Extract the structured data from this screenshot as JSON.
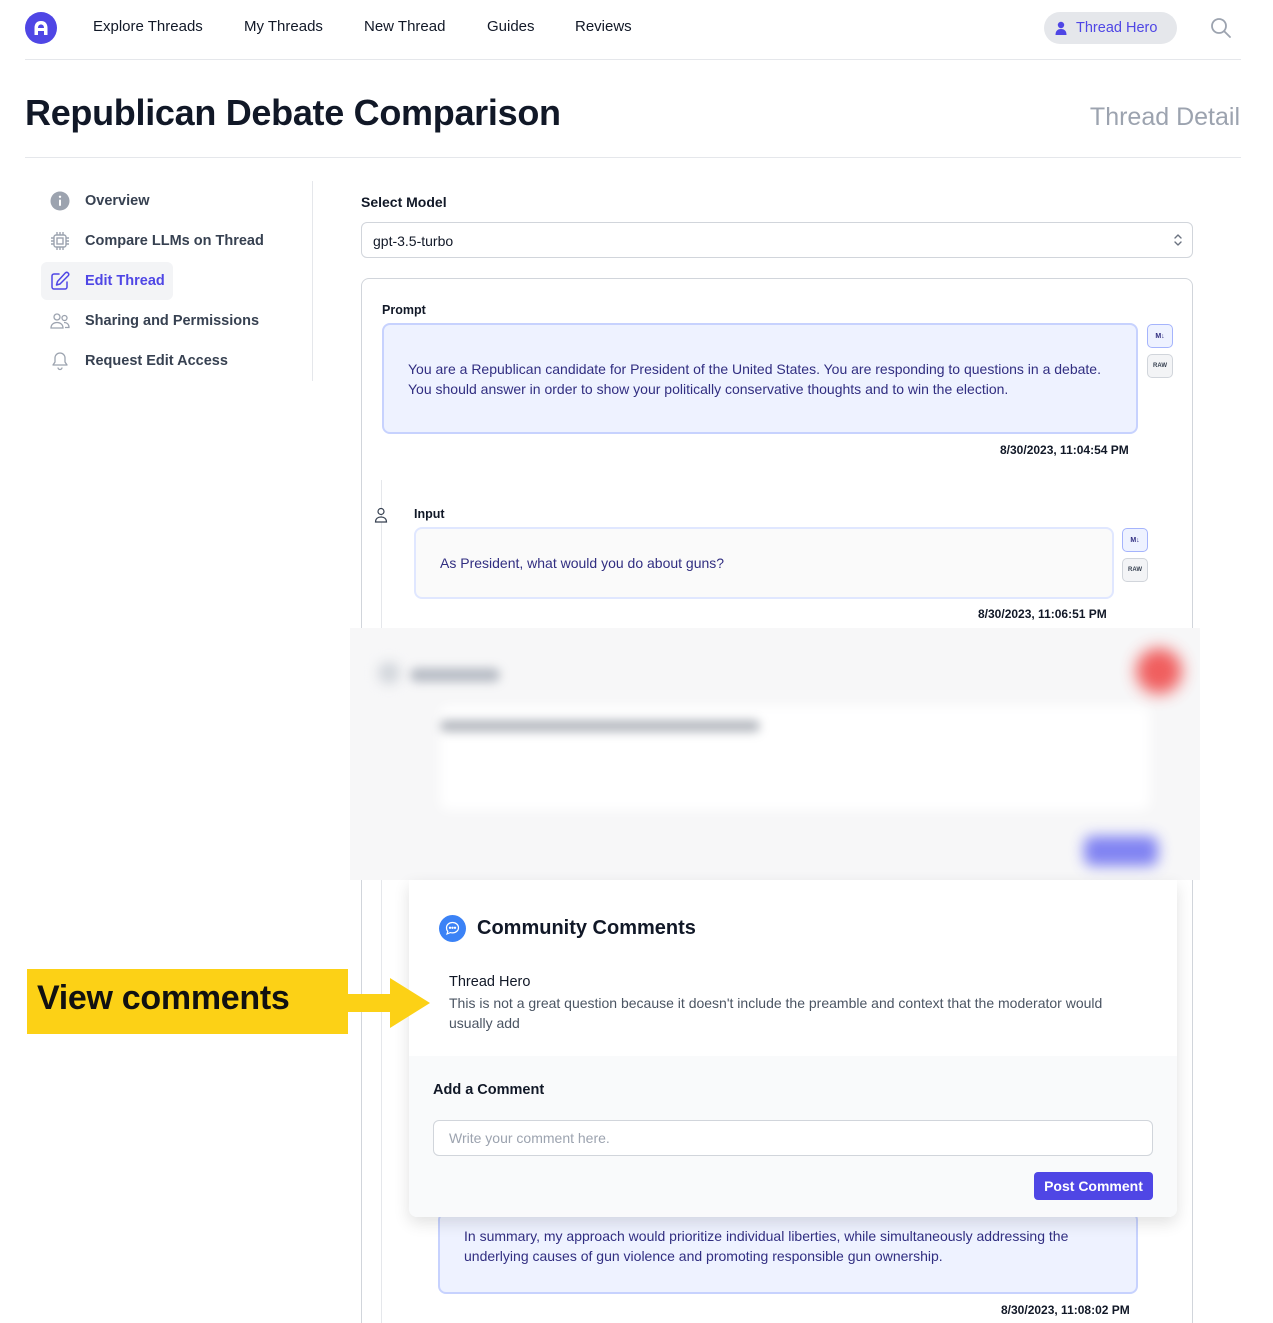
{
  "nav": {
    "items": [
      "Explore Threads",
      "My Threads",
      "New Thread",
      "Guides",
      "Reviews"
    ],
    "user_name": "Thread Hero",
    "brand_color": "#4f46e5"
  },
  "page": {
    "title": "Republican Debate Comparison",
    "subtitle": "Thread Detail"
  },
  "sidebar": {
    "items": [
      {
        "label": "Overview",
        "icon": "info-icon"
      },
      {
        "label": "Compare LLMs on Thread",
        "icon": "cpu-chip-icon"
      },
      {
        "label": "Edit Thread",
        "icon": "edit-icon",
        "active": true
      },
      {
        "label": "Sharing and Permissions",
        "icon": "users-icon"
      },
      {
        "label": "Request Edit Access",
        "icon": "bell-icon"
      }
    ]
  },
  "model_select": {
    "label": "Select Model",
    "value": "gpt-3.5-turbo"
  },
  "thread": {
    "prompt": {
      "label": "Prompt",
      "text": "You are a Republican candidate for President of the United States. You are responding to questions in a debate. You should answer in order to show your politically conservative thoughts and to win the election.",
      "timestamp": "8/30/2023, 11:04:54 PM"
    },
    "input": {
      "label": "Input",
      "text": "As President, what would you do about guns?",
      "timestamp": "8/30/2023, 11:06:51 PM"
    },
    "response": {
      "text": "In summary, my approach would prioritize individual liberties, while simultaneously addressing the underlying causes of gun violence and promoting responsible gun ownership.",
      "timestamp": "8/30/2023, 11:08:02 PM"
    },
    "md_button": "M↓",
    "raw_button": "RAW"
  },
  "comments": {
    "title": "Community Comments",
    "items": [
      {
        "author": "Thread Hero",
        "text": "This is not a great question because it doesn't include the preamble and context that the moderator would usually add"
      }
    ],
    "form_label": "Add a Comment",
    "placeholder": "Write your comment here.",
    "post_label": "Post Comment"
  },
  "callout": {
    "text": "View comments",
    "color": "#fcd116"
  }
}
